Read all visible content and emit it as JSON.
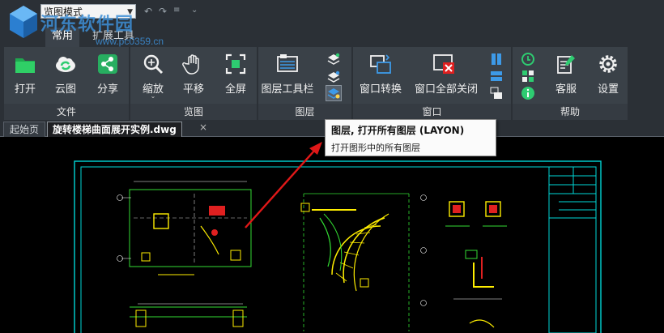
{
  "titlebar": {
    "mode_value": "览图模式",
    "watermark": "河东软件园",
    "watermark_url": "www.pc0359.cn",
    "quick_access": {
      "undo": "↶",
      "redo": "↷",
      "more": "≡"
    }
  },
  "menu_tabs": {
    "common": "常用",
    "extensions": "扩展工具"
  },
  "ribbon": {
    "groups": {
      "file": "文件",
      "view": "览图",
      "layer": "图层",
      "window": "窗口",
      "help": "帮助"
    },
    "tools": {
      "open": "打开",
      "cloud": "云图",
      "share": "分享",
      "zoom": "缩放",
      "pan": "平移",
      "fullscreen": "全屏",
      "layer_toolbar": "图层工具栏",
      "window_switch": "窗口转换",
      "close_all": "窗口全部关闭",
      "service": "客服",
      "settings": "设置"
    },
    "dropdown_caret": "⌄"
  },
  "doc_tabs": {
    "start": "起始页",
    "file": "旋转楼梯曲面展开实例.dwg",
    "close_glyph": "×"
  },
  "tooltip": {
    "title": "图层, 打开所有图层 (LAYON)",
    "description": "打开图形中的所有图层"
  },
  "colors": {
    "ribbon_bg": "#3a4148",
    "app_bg": "#2b3036",
    "canvas_bg": "#000000",
    "drawing_frame": "#00d7d7",
    "drawing_yellow": "#ffee00",
    "drawing_green": "#33dd33",
    "drawing_red": "#e02020",
    "arrow_red": "#e01818",
    "icon_green": "#2ecc71",
    "icon_blue": "#3d9ae8"
  },
  "icons": [
    "app-logo-icon",
    "undo-icon",
    "redo-icon",
    "quick-access-menu-icon",
    "folder-open-icon",
    "cloud-sync-icon",
    "share-icon",
    "magnifier-icon",
    "hand-pan-icon",
    "fullscreen-icon",
    "layer-toolbar-icon",
    "layer-on-icon",
    "layer-off-icon",
    "layer-open-all-icon",
    "window-switch-icon",
    "window-close-all-icon",
    "service-icon",
    "gear-icon",
    "info-icon"
  ]
}
